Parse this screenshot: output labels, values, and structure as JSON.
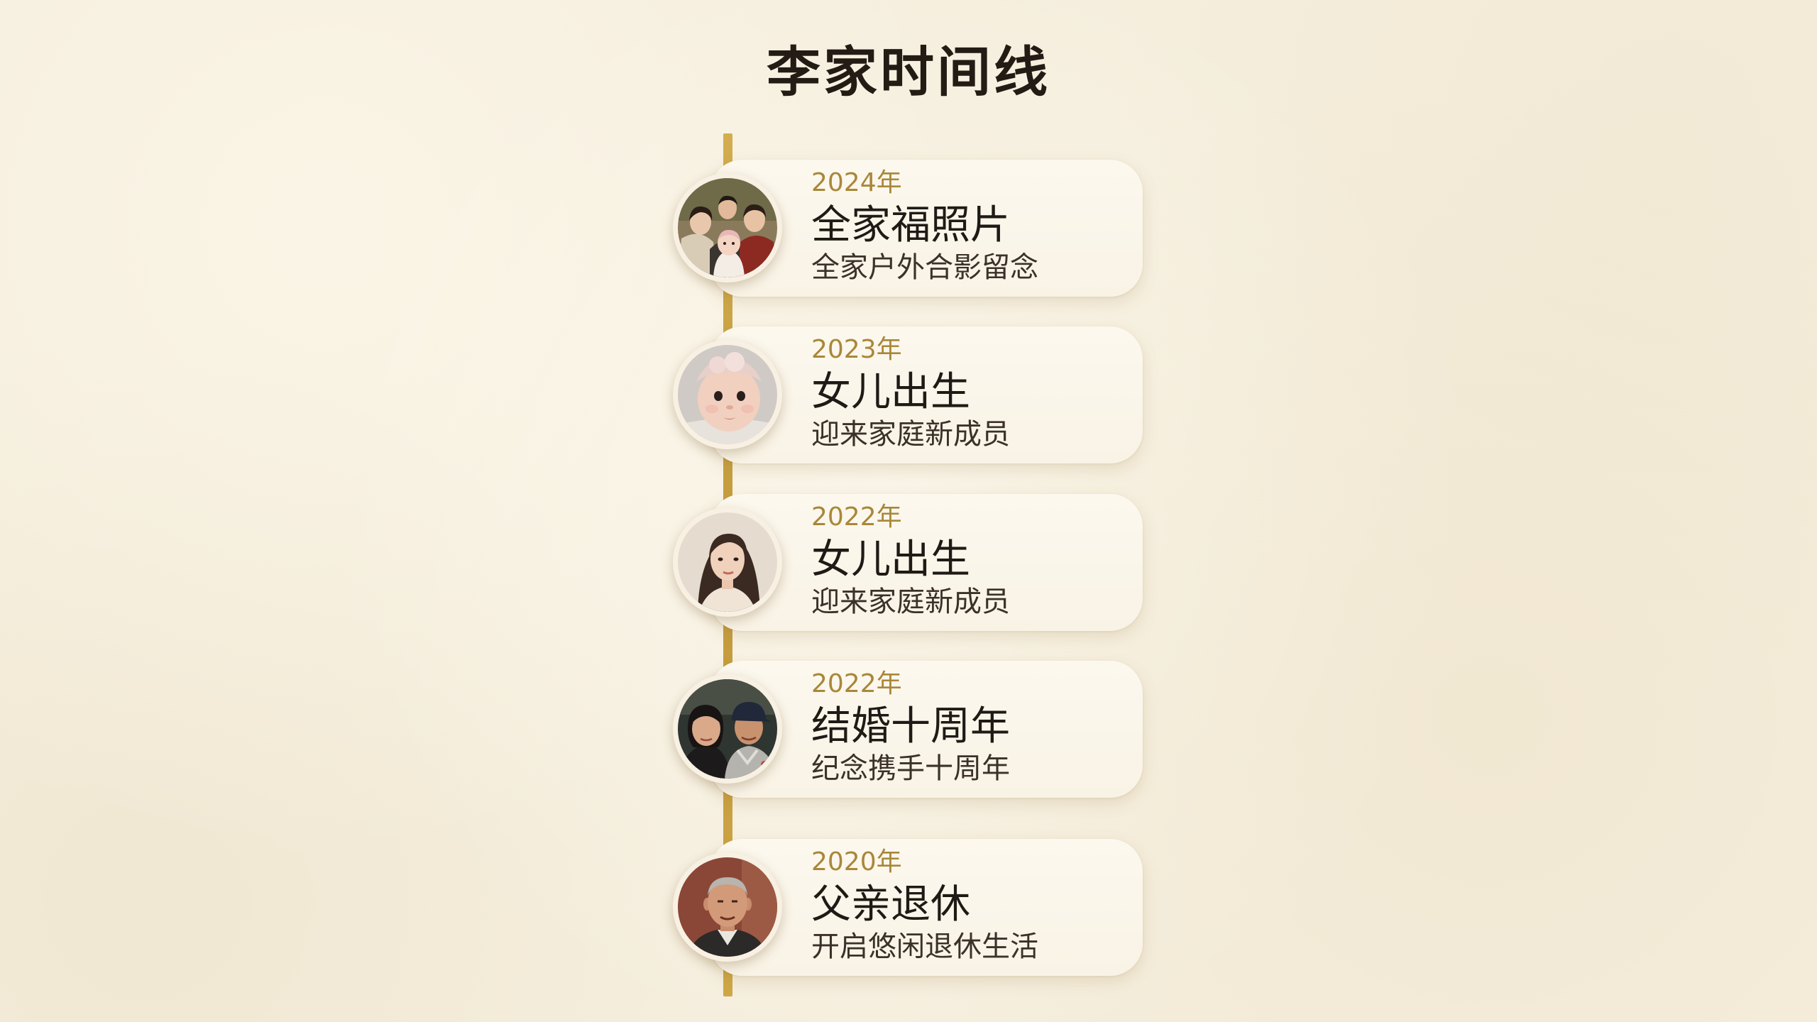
{
  "page": {
    "title": "李家时间线"
  },
  "colors": {
    "background": "#f5eedd",
    "accent": "#c9a240",
    "card": "#fbf6eb",
    "year_text": "#a9873a",
    "title_text": "#1f1a15",
    "description_text": "#3b3129"
  },
  "events": [
    {
      "year": "2024年",
      "title": "全家福照片",
      "description": "全家户外合影留念"
    },
    {
      "year": "2023年",
      "title": "女儿出生",
      "description": "迎来家庭新成员"
    },
    {
      "year": "2022年",
      "title": "女儿出生",
      "description": "迎来家庭新成员"
    },
    {
      "year": "2022年",
      "title": "结婚十周年",
      "description": "纪念携手十周年"
    },
    {
      "year": "2020年",
      "title": "父亲退休",
      "description": "开启悠闲退休生活"
    }
  ]
}
